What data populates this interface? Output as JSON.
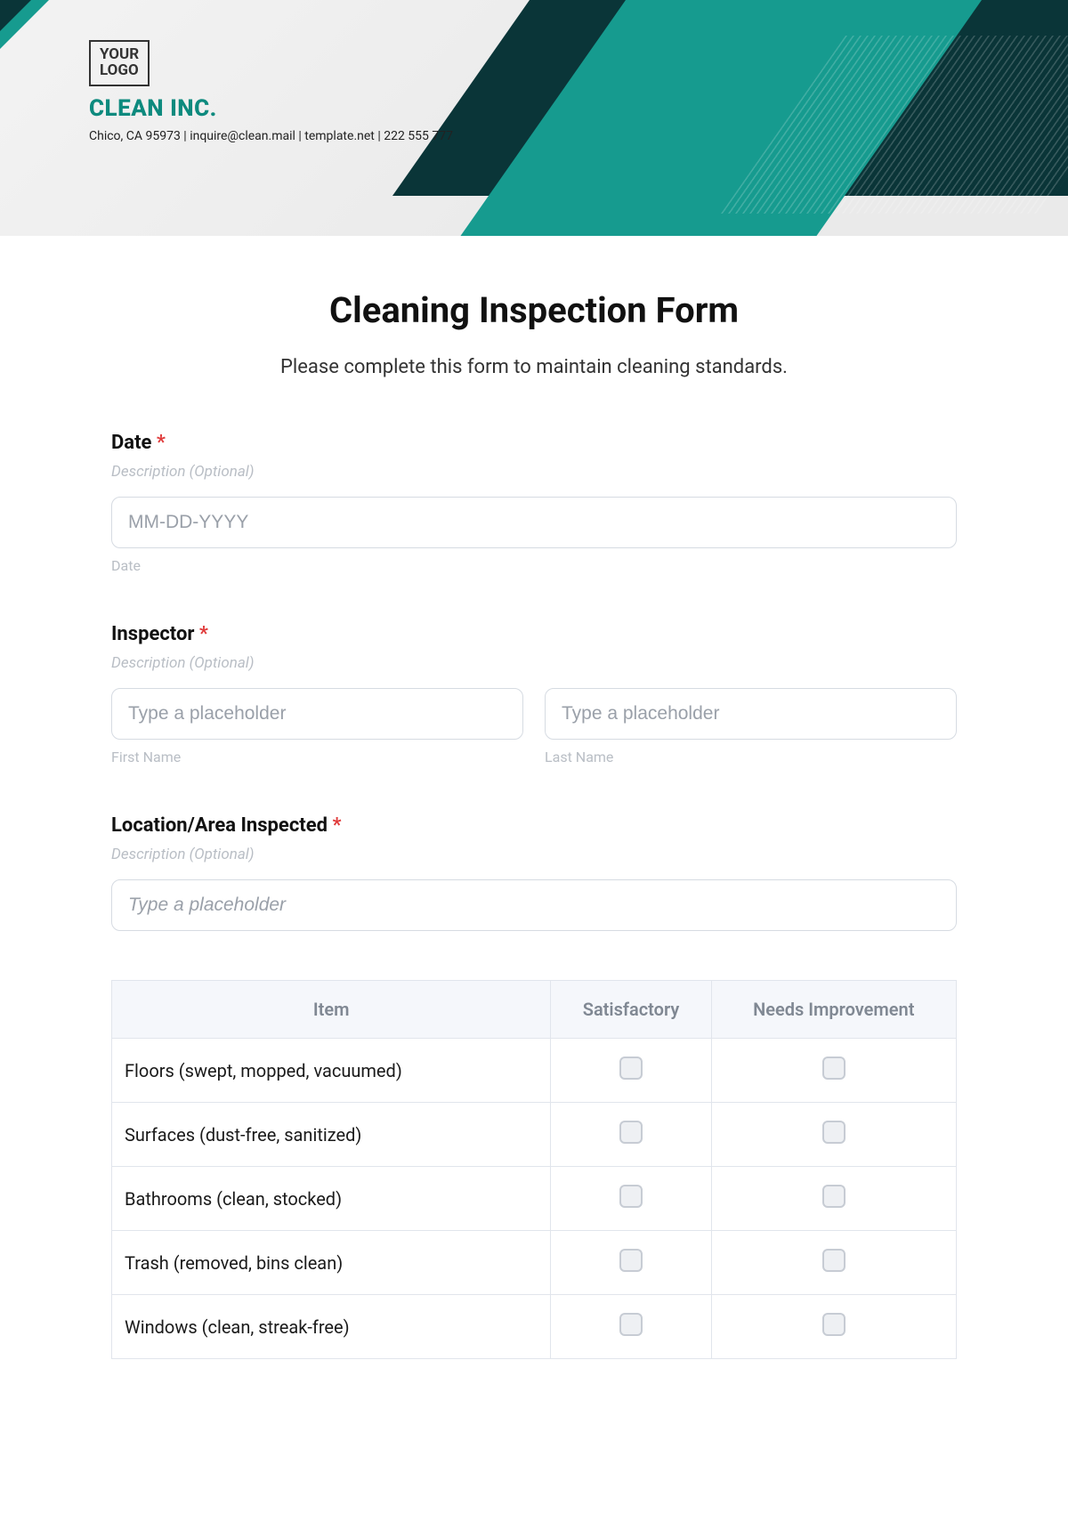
{
  "header": {
    "logo_line1": "YOUR",
    "logo_line2": "LOGO",
    "company_name": "CLEAN INC.",
    "contact_line": "Chico, CA 95973 | inquire@clean.mail | template.net | 222 555 777"
  },
  "form": {
    "title": "Cleaning Inspection Form",
    "subtitle": "Please complete this form to maintain cleaning standards.",
    "required_mark": "*",
    "description_placeholder": "Description (Optional)",
    "date": {
      "label": "Date",
      "placeholder": "MM-DD-YYYY",
      "sublabel": "Date"
    },
    "inspector": {
      "label": "Inspector",
      "first_placeholder": "Type a placeholder",
      "last_placeholder": "Type a placeholder",
      "first_sublabel": "First Name",
      "last_sublabel": "Last Name"
    },
    "location": {
      "label": "Location/Area Inspected",
      "placeholder": "Type a placeholder"
    },
    "table": {
      "columns": [
        "Item",
        "Satisfactory",
        "Needs Improvement"
      ],
      "rows": [
        "Floors (swept, mopped, vacuumed)",
        "Surfaces (dust-free, sanitized)",
        "Bathrooms (clean, stocked)",
        "Trash (removed, bins clean)",
        "Windows (clean, streak-free)"
      ]
    }
  }
}
